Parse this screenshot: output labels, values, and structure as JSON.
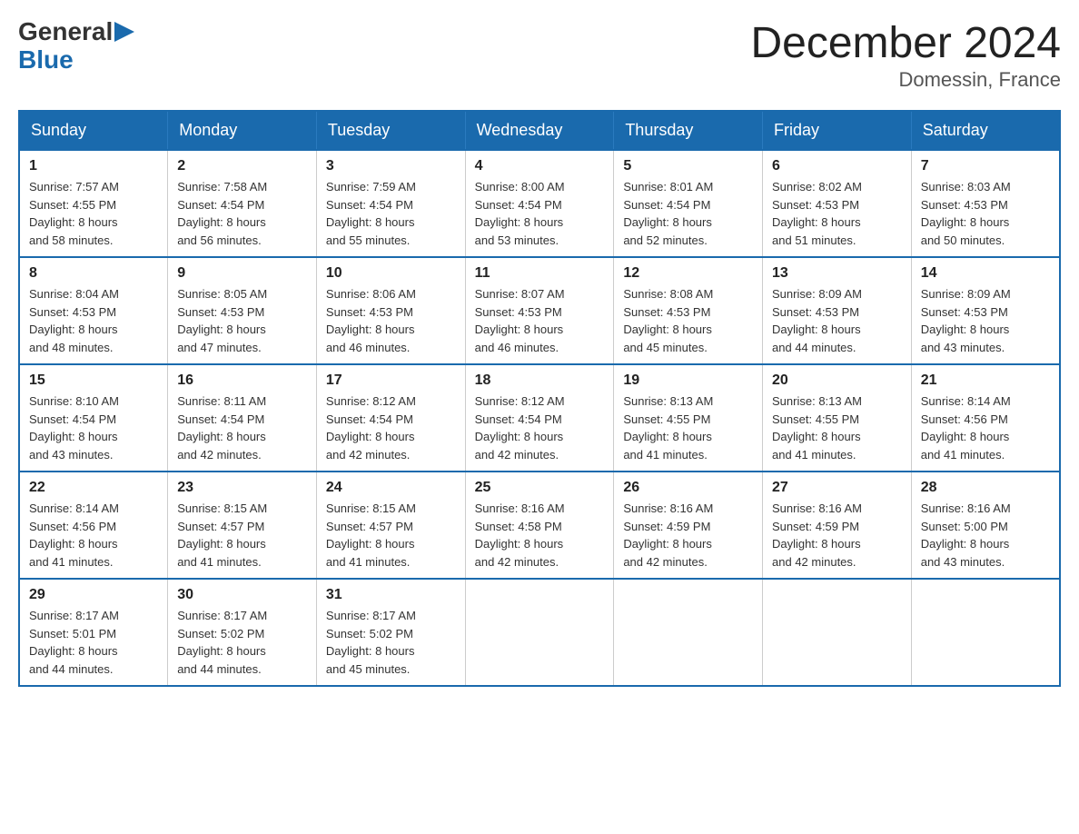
{
  "logo": {
    "general": "General",
    "blue": "Blue",
    "arrow": "▶"
  },
  "title": "December 2024",
  "subtitle": "Domessin, France",
  "days": [
    "Sunday",
    "Monday",
    "Tuesday",
    "Wednesday",
    "Thursday",
    "Friday",
    "Saturday"
  ],
  "weeks": [
    [
      {
        "day": "1",
        "sunrise": "7:57 AM",
        "sunset": "4:55 PM",
        "daylight": "8 hours and 58 minutes."
      },
      {
        "day": "2",
        "sunrise": "7:58 AM",
        "sunset": "4:54 PM",
        "daylight": "8 hours and 56 minutes."
      },
      {
        "day": "3",
        "sunrise": "7:59 AM",
        "sunset": "4:54 PM",
        "daylight": "8 hours and 55 minutes."
      },
      {
        "day": "4",
        "sunrise": "8:00 AM",
        "sunset": "4:54 PM",
        "daylight": "8 hours and 53 minutes."
      },
      {
        "day": "5",
        "sunrise": "8:01 AM",
        "sunset": "4:54 PM",
        "daylight": "8 hours and 52 minutes."
      },
      {
        "day": "6",
        "sunrise": "8:02 AM",
        "sunset": "4:53 PM",
        "daylight": "8 hours and 51 minutes."
      },
      {
        "day": "7",
        "sunrise": "8:03 AM",
        "sunset": "4:53 PM",
        "daylight": "8 hours and 50 minutes."
      }
    ],
    [
      {
        "day": "8",
        "sunrise": "8:04 AM",
        "sunset": "4:53 PM",
        "daylight": "8 hours and 48 minutes."
      },
      {
        "day": "9",
        "sunrise": "8:05 AM",
        "sunset": "4:53 PM",
        "daylight": "8 hours and 47 minutes."
      },
      {
        "day": "10",
        "sunrise": "8:06 AM",
        "sunset": "4:53 PM",
        "daylight": "8 hours and 46 minutes."
      },
      {
        "day": "11",
        "sunrise": "8:07 AM",
        "sunset": "4:53 PM",
        "daylight": "8 hours and 46 minutes."
      },
      {
        "day": "12",
        "sunrise": "8:08 AM",
        "sunset": "4:53 PM",
        "daylight": "8 hours and 45 minutes."
      },
      {
        "day": "13",
        "sunrise": "8:09 AM",
        "sunset": "4:53 PM",
        "daylight": "8 hours and 44 minutes."
      },
      {
        "day": "14",
        "sunrise": "8:09 AM",
        "sunset": "4:53 PM",
        "daylight": "8 hours and 43 minutes."
      }
    ],
    [
      {
        "day": "15",
        "sunrise": "8:10 AM",
        "sunset": "4:54 PM",
        "daylight": "8 hours and 43 minutes."
      },
      {
        "day": "16",
        "sunrise": "8:11 AM",
        "sunset": "4:54 PM",
        "daylight": "8 hours and 42 minutes."
      },
      {
        "day": "17",
        "sunrise": "8:12 AM",
        "sunset": "4:54 PM",
        "daylight": "8 hours and 42 minutes."
      },
      {
        "day": "18",
        "sunrise": "8:12 AM",
        "sunset": "4:54 PM",
        "daylight": "8 hours and 42 minutes."
      },
      {
        "day": "19",
        "sunrise": "8:13 AM",
        "sunset": "4:55 PM",
        "daylight": "8 hours and 41 minutes."
      },
      {
        "day": "20",
        "sunrise": "8:13 AM",
        "sunset": "4:55 PM",
        "daylight": "8 hours and 41 minutes."
      },
      {
        "day": "21",
        "sunrise": "8:14 AM",
        "sunset": "4:56 PM",
        "daylight": "8 hours and 41 minutes."
      }
    ],
    [
      {
        "day": "22",
        "sunrise": "8:14 AM",
        "sunset": "4:56 PM",
        "daylight": "8 hours and 41 minutes."
      },
      {
        "day": "23",
        "sunrise": "8:15 AM",
        "sunset": "4:57 PM",
        "daylight": "8 hours and 41 minutes."
      },
      {
        "day": "24",
        "sunrise": "8:15 AM",
        "sunset": "4:57 PM",
        "daylight": "8 hours and 41 minutes."
      },
      {
        "day": "25",
        "sunrise": "8:16 AM",
        "sunset": "4:58 PM",
        "daylight": "8 hours and 42 minutes."
      },
      {
        "day": "26",
        "sunrise": "8:16 AM",
        "sunset": "4:59 PM",
        "daylight": "8 hours and 42 minutes."
      },
      {
        "day": "27",
        "sunrise": "8:16 AM",
        "sunset": "4:59 PM",
        "daylight": "8 hours and 42 minutes."
      },
      {
        "day": "28",
        "sunrise": "8:16 AM",
        "sunset": "5:00 PM",
        "daylight": "8 hours and 43 minutes."
      }
    ],
    [
      {
        "day": "29",
        "sunrise": "8:17 AM",
        "sunset": "5:01 PM",
        "daylight": "8 hours and 44 minutes."
      },
      {
        "day": "30",
        "sunrise": "8:17 AM",
        "sunset": "5:02 PM",
        "daylight": "8 hours and 44 minutes."
      },
      {
        "day": "31",
        "sunrise": "8:17 AM",
        "sunset": "5:02 PM",
        "daylight": "8 hours and 45 minutes."
      },
      null,
      null,
      null,
      null
    ]
  ],
  "labels": {
    "sunrise": "Sunrise:",
    "sunset": "Sunset:",
    "daylight": "Daylight:"
  }
}
